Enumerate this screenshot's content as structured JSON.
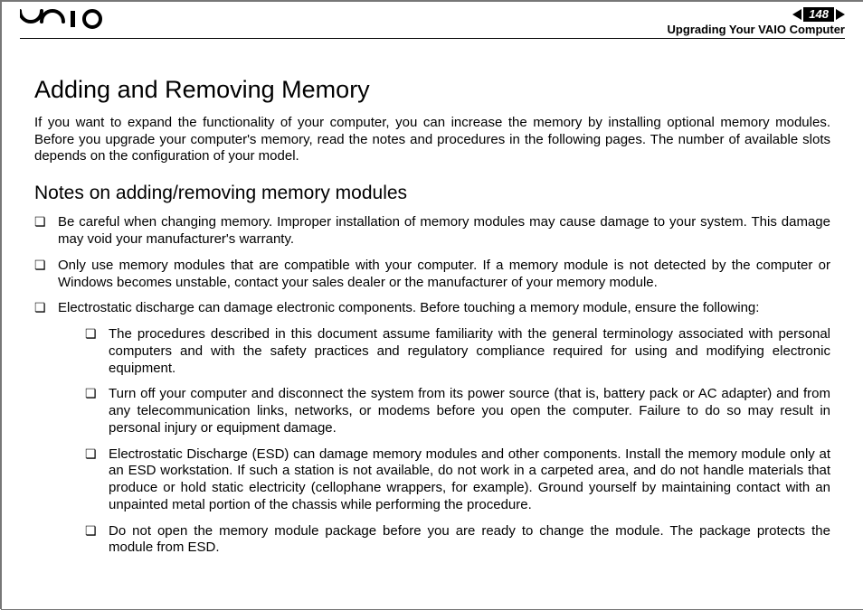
{
  "header": {
    "brand_logo_name": "vaio-logo",
    "page_number": "148",
    "section": "Upgrading Your VAIO Computer",
    "nav_prev_name": "prev-page-arrow",
    "nav_next_name": "next-page-arrow"
  },
  "heading": "Adding and Removing Memory",
  "intro": "If you want to expand the functionality of your computer, you can increase the memory by installing optional memory modules. Before you upgrade your computer's memory, read the notes and procedures in the following pages. The number of available slots depends on the configuration of your model.",
  "subheading": "Notes on adding/removing memory modules",
  "notes": [
    "Be careful when changing memory. Improper installation of memory modules may cause damage to your system. This damage may void your manufacturer's warranty.",
    "Only use memory modules that are compatible with your computer. If a memory module is not detected by the computer or Windows becomes unstable, contact your sales dealer or the manufacturer of your memory module.",
    "Electrostatic discharge can damage electronic components. Before touching a memory module, ensure the following:"
  ],
  "subnotes": [
    "The procedures described in this document assume familiarity with the general terminology associated with personal computers and with the safety practices and regulatory compliance required for using and modifying electronic equipment.",
    "Turn off your computer and disconnect the system from its power source (that is, battery pack or AC adapter) and from any telecommunication links, networks, or modems before you open the computer. Failure to do so may result in personal injury or equipment damage.",
    "Electrostatic Discharge (ESD) can damage memory modules and other components. Install the memory module only at an ESD workstation. If such a station is not available, do not work in a carpeted area, and do not handle materials that produce or hold static electricity (cellophane wrappers, for example). Ground yourself by maintaining contact with an unpainted metal portion of the chassis while performing the procedure.",
    "Do not open the memory module package before you are ready to change the module. The package protects the module from ESD."
  ]
}
